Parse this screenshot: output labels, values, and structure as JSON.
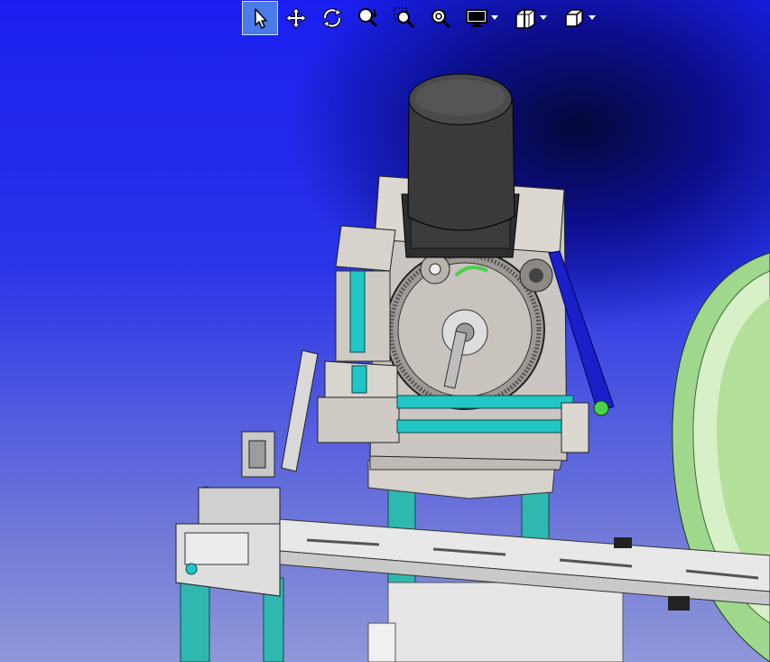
{
  "toolbar": {
    "tools": [
      {
        "id": "select",
        "icon": "select-arrow-icon",
        "active": true
      },
      {
        "id": "pan",
        "icon": "pan-move-icon",
        "active": false
      },
      {
        "id": "rotate",
        "icon": "rotate-icon",
        "active": false
      },
      {
        "id": "zoom-dynamic",
        "icon": "zoom-dynamic-icon",
        "active": false
      },
      {
        "id": "zoom-area",
        "icon": "zoom-area-icon",
        "active": false
      },
      {
        "id": "zoom-fit",
        "icon": "zoom-fit-icon",
        "active": false
      },
      {
        "id": "display-mode",
        "icon": "monitor-icon",
        "active": false
      },
      {
        "id": "section-view",
        "icon": "section-view-icon",
        "active": false
      },
      {
        "id": "view-orientation",
        "icon": "cube-view-icon",
        "active": false
      }
    ]
  },
  "scene": {
    "background_top": "#1a1ff0",
    "background_bottom": "#8f98d8",
    "part_color": "#d9d9d9",
    "shaft_color": "#22c6c6",
    "belt_color": "#1a1fc8",
    "motor_color": "#3a3a3a",
    "bowl_color": "#bfe6a8",
    "gear_highlight": "#49d24a"
  }
}
